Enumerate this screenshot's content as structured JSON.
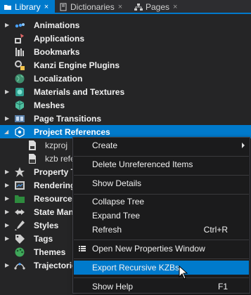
{
  "tabs": [
    {
      "label": "Library",
      "active": true
    },
    {
      "label": "Dictionaries",
      "active": false
    },
    {
      "label": "Pages",
      "active": false
    }
  ],
  "tab_close_glyph": "×",
  "tree": [
    {
      "label": "Animations",
      "icon": "animation-icon",
      "expandable": true
    },
    {
      "label": "Applications",
      "icon": "applications-icon",
      "expandable": false
    },
    {
      "label": "Bookmarks",
      "icon": "bookmarks-icon",
      "expandable": false
    },
    {
      "label": "Kanzi Engine Plugins",
      "icon": "plugins-icon",
      "expandable": false
    },
    {
      "label": "Localization",
      "icon": "globe-icon",
      "expandable": false
    },
    {
      "label": "Materials and Textures",
      "icon": "materials-icon",
      "expandable": true
    },
    {
      "label": "Meshes",
      "icon": "meshes-icon",
      "expandable": false
    },
    {
      "label": "Page Transitions",
      "icon": "page-transitions-icon",
      "expandable": true
    },
    {
      "label": "Project References",
      "icon": "project-references-icon",
      "expandable": true,
      "expanded": true,
      "selected": true
    },
    {
      "label": "kzproj",
      "icon": "kzproj-file-icon",
      "child": true
    },
    {
      "label": "kzb refe",
      "icon": "kzb-file-icon",
      "child": true
    },
    {
      "label": "Property T",
      "icon": "property-types-icon",
      "expandable": true
    },
    {
      "label": "Rendering",
      "icon": "rendering-icon",
      "expandable": true
    },
    {
      "label": "Resource",
      "icon": "resource-files-icon",
      "expandable": true
    },
    {
      "label": "State Man",
      "icon": "state-managers-icon",
      "expandable": true
    },
    {
      "label": "Styles",
      "icon": "styles-icon",
      "expandable": true
    },
    {
      "label": "Tags",
      "icon": "tags-icon",
      "expandable": true
    },
    {
      "label": "Themes",
      "icon": "themes-icon",
      "expandable": false
    },
    {
      "label": "Trajectorie",
      "icon": "trajectories-icon",
      "expandable": true
    }
  ],
  "context_menu": {
    "items": [
      {
        "label": "Create",
        "submenu": true
      },
      {
        "separator": true
      },
      {
        "label": "Delete Unreferenced Items"
      },
      {
        "separator": true
      },
      {
        "label": "Show Details"
      },
      {
        "separator": true
      },
      {
        "label": "Collapse Tree"
      },
      {
        "label": "Expand Tree"
      },
      {
        "label": "Refresh",
        "shortcut": "Ctrl+R"
      },
      {
        "separator": true
      },
      {
        "label": "Open New Properties Window",
        "icon": "properties-window-icon"
      },
      {
        "separator": true
      },
      {
        "label": "Export Recursive KZBs",
        "hover": true
      },
      {
        "separator": true
      },
      {
        "label": "Show Help",
        "shortcut": "F1"
      }
    ]
  },
  "colors": {
    "accent": "#007acc",
    "panel_bg": "#252526",
    "menu_bg": "#1b1b1c"
  }
}
